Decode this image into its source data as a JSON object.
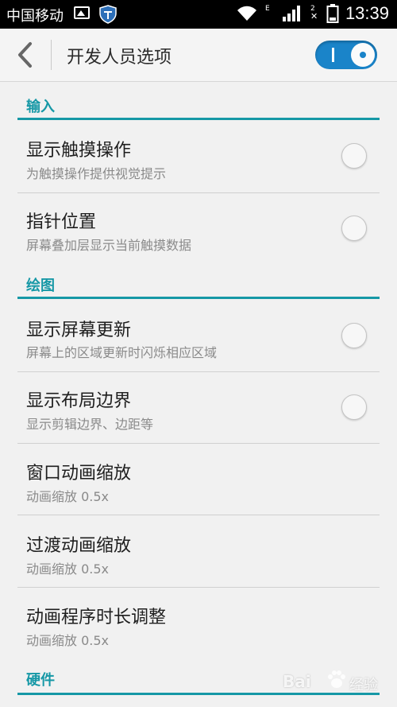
{
  "status_bar": {
    "carrier": "中国移动",
    "network_e": "E",
    "network_2": "2",
    "time": "13:39"
  },
  "toolbar": {
    "title": "开发人员选项",
    "master_switch_on": true
  },
  "sections": {
    "input": {
      "title": "输入"
    },
    "drawing": {
      "title": "绘图"
    },
    "hardware": {
      "title": "硬件"
    }
  },
  "items": [
    {
      "title": "显示触摸操作",
      "subtitle": "为触摸操作提供视觉提示",
      "checked": false
    },
    {
      "title": "指针位置",
      "subtitle": "屏幕叠加层显示当前触摸数据",
      "checked": false
    },
    {
      "title": "显示屏幕更新",
      "subtitle": "屏幕上的区域更新时闪烁相应区域",
      "checked": false
    },
    {
      "title": "显示布局边界",
      "subtitle": "显示剪辑边界、边距等",
      "checked": false
    },
    {
      "title": "窗口动画缩放",
      "subtitle": "动画缩放 0.5x"
    },
    {
      "title": "过渡动画缩放",
      "subtitle": "动画缩放 0.5x"
    },
    {
      "title": "动画程序时长调整",
      "subtitle": "动画缩放 0.5x"
    }
  ],
  "watermark": {
    "text": "Bai",
    "cn": "经验"
  },
  "colors": {
    "accent": "#1698a6",
    "switch": "#1a84c9"
  }
}
